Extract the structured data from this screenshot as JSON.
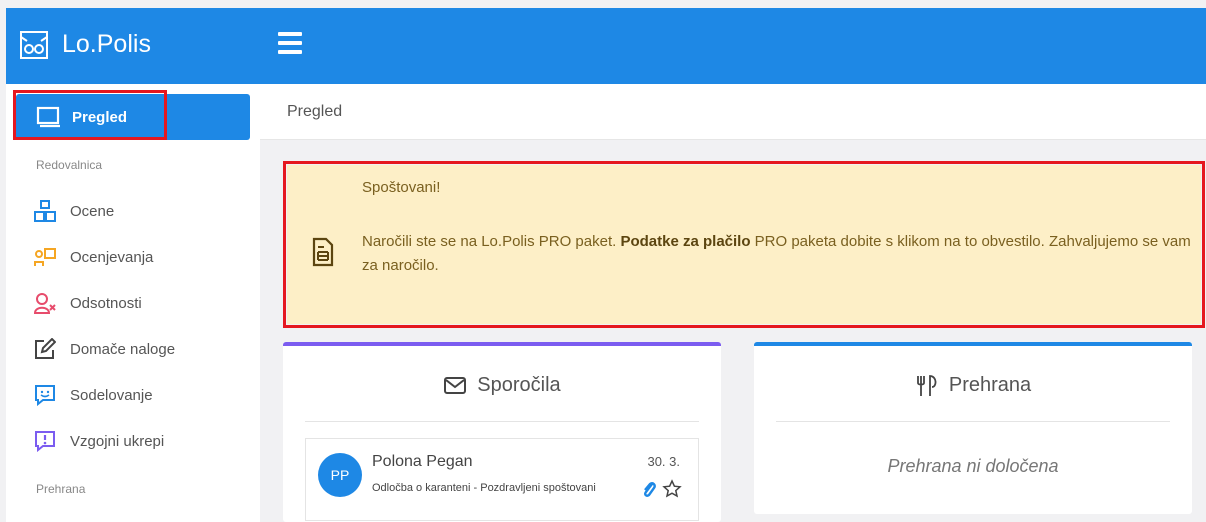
{
  "app": {
    "name": "Lo.Polis"
  },
  "breadcrumb": "Pregled",
  "sidebar": {
    "active_label": "Pregled",
    "section_redovalnica": "Redovalnica",
    "items": [
      {
        "label": "Ocene",
        "icon": "blocks-icon"
      },
      {
        "label": "Ocenjevanja",
        "icon": "presenter-icon"
      },
      {
        "label": "Odsotnosti",
        "icon": "user-x-icon"
      },
      {
        "label": "Domače naloge",
        "icon": "edit-icon"
      },
      {
        "label": "Sodelovanje",
        "icon": "smile-chat-icon"
      },
      {
        "label": "Vzgojni ukrepi",
        "icon": "alert-chat-icon"
      }
    ],
    "section_prehrana": "Prehrana"
  },
  "notice": {
    "greeting": "Spoštovani!",
    "text_before": "Naročili ste se na Lo.Polis PRO paket. ",
    "text_bold": "Podatke za plačilo",
    "text_after": " PRO paketa dobite s klikom na to obvestilo. Zahvaljujemo se vam za naročilo."
  },
  "messages_card": {
    "title": "Sporočila",
    "items": [
      {
        "initials": "PP",
        "from": "Polona Pegan",
        "date": "30. 3.",
        "subject": "Odločba o karanteni - Pozdravljeni spoštovani"
      }
    ]
  },
  "food_card": {
    "title": "Prehrana",
    "empty_text": "Prehrana ni določena"
  },
  "colors": {
    "primary": "#1e88e5",
    "notice_bg": "#fdefc7",
    "highlight": "#e5171f",
    "messages_accent": "#7b5cf0"
  }
}
